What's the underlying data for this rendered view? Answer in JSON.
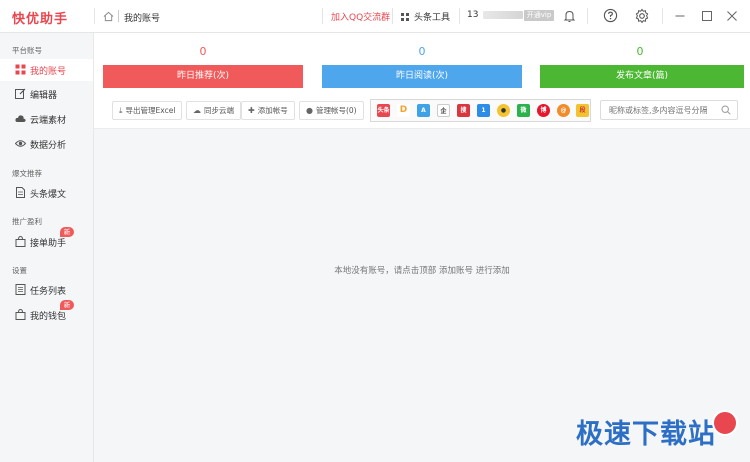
{
  "app": {
    "title": "快优助手"
  },
  "header": {
    "breadcrumb": "我的账号",
    "qq_group": "加入QQ交流群",
    "tools": "头条工具",
    "phone_prefix": "13",
    "vip_label": "开通vip"
  },
  "sidebar": {
    "sections": [
      {
        "title": "平台账号"
      },
      {
        "title": "爆文推荐"
      },
      {
        "title": "推广盈利"
      },
      {
        "title": "设置"
      }
    ],
    "items": [
      {
        "label": "我的账号",
        "icon": "grid-icon",
        "active": true
      },
      {
        "label": "编辑器",
        "icon": "edit-icon"
      },
      {
        "label": "云端素材",
        "icon": "cloud-icon"
      },
      {
        "label": "数据分析",
        "icon": "eye-icon"
      },
      {
        "label": "头条爆文",
        "icon": "document-icon"
      },
      {
        "label": "接单助手",
        "icon": "bag-icon",
        "badge": "新"
      },
      {
        "label": "任务列表",
        "icon": "list-icon"
      },
      {
        "label": "我的钱包",
        "icon": "wallet-icon",
        "badge": "新"
      }
    ]
  },
  "stats": [
    {
      "value": "0",
      "label": "昨日推荐(次)",
      "color": "#f05a5a"
    },
    {
      "value": "0",
      "label": "昨日阅读(次)",
      "color": "#4ea6ec"
    },
    {
      "value": "0",
      "label": "发布文章(篇)",
      "color": "#4cb733"
    }
  ],
  "toolbar": {
    "export": "导出管理Excel",
    "sync": "同步云端",
    "add": "添加帐号",
    "manage": "管理帐号(0)"
  },
  "platforms": [
    {
      "name": "toutiao",
      "text": "头条",
      "color": "#e8474f"
    },
    {
      "name": "baijia",
      "text": "D",
      "color": "#f4a22b"
    },
    {
      "name": "dayu",
      "text": "A",
      "color": "#3ea2e6"
    },
    {
      "name": "qie",
      "text": "企",
      "color": "#ffffff"
    },
    {
      "name": "sohu",
      "text": "搜",
      "color": "#d9373f"
    },
    {
      "name": "yidian",
      "text": "1",
      "color": "#2d8ce8"
    },
    {
      "name": "wangyi",
      "text": "●",
      "color": "#f3c42f"
    },
    {
      "name": "wechat",
      "text": "微",
      "color": "#2bb24c"
    },
    {
      "name": "weibo",
      "text": "博",
      "color": "#e6162d"
    },
    {
      "name": "uc",
      "text": "@",
      "color": "#f08c2a"
    },
    {
      "name": "other",
      "text": "段",
      "color": "#f2c230"
    }
  ],
  "search": {
    "placeholder": "昵称或标签,多内容逗号分隔"
  },
  "main": {
    "empty_message": "本地没有账号，请点击顶部 添加账号 进行添加"
  },
  "watermark": "极速下载站"
}
